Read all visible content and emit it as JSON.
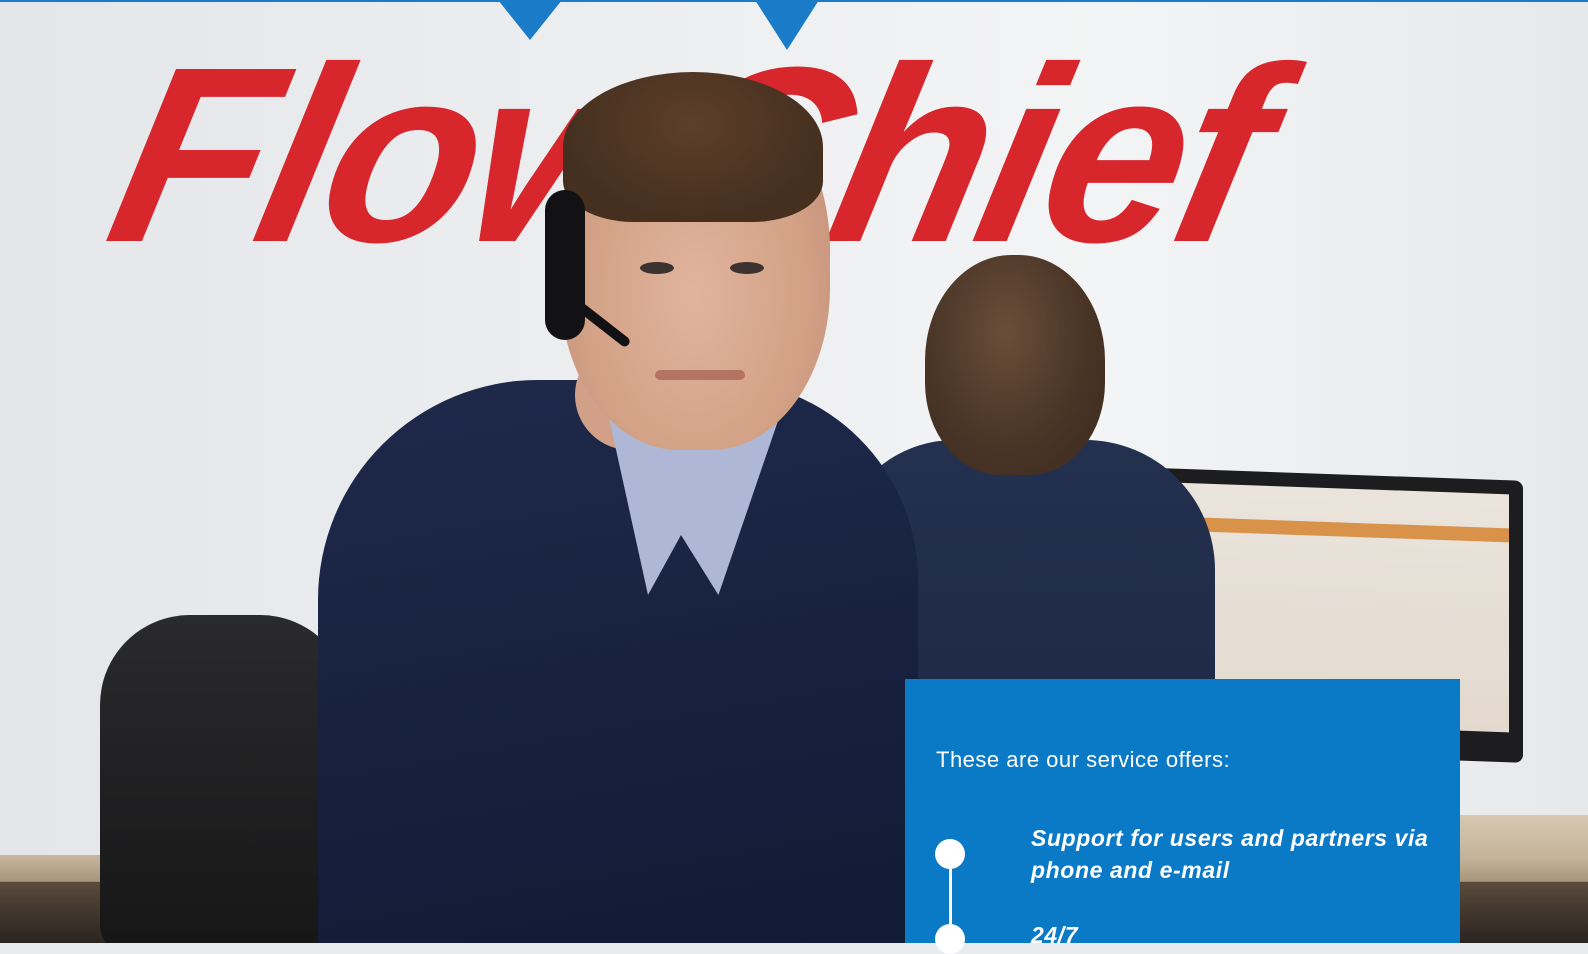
{
  "brand": {
    "logo_text": "FlowChief",
    "colors": {
      "accent_blue": "#0b7ac6",
      "logo_red": "#d7262c",
      "top_bar": "#1a7cc9"
    }
  },
  "photo": {
    "description_icon": "support-agent-photo"
  },
  "service_panel": {
    "intro": "These are our service offers:",
    "offers": [
      {
        "label": "Support for users and partners via phone and e-mail"
      },
      {
        "label": "24/7"
      }
    ]
  }
}
